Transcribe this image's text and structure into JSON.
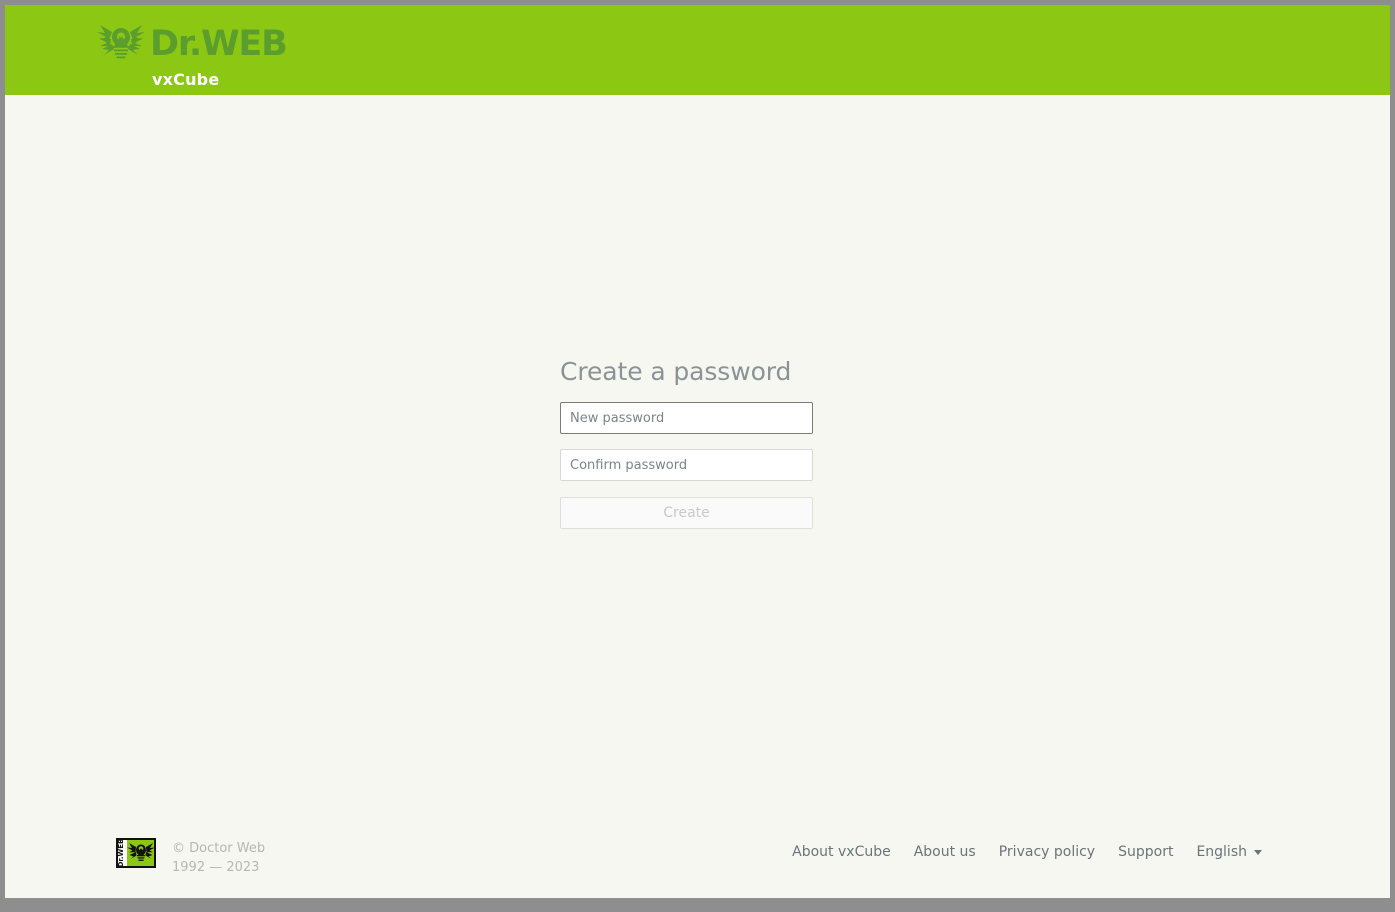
{
  "header": {
    "brand_name": "Dr.WEB",
    "product_name": "vxCube",
    "logo_icon": "dr-web-spider-icon",
    "background_color": "#8cc813",
    "wordmark_color": "#5c9e2e"
  },
  "main": {
    "title": "Create a password",
    "new_password": {
      "placeholder": "New password",
      "value": "",
      "focused": true
    },
    "confirm_password": {
      "placeholder": "Confirm password",
      "value": "",
      "focused": false
    },
    "submit": {
      "label": "Create",
      "disabled": true
    }
  },
  "footer": {
    "badge_icon": "dr-web-badge-icon",
    "badge_text": "Dr.WEB",
    "copyright_line1": "© Doctor Web",
    "copyright_line2": "1992 — 2023",
    "links": [
      {
        "label": "About vxCube"
      },
      {
        "label": "About us"
      },
      {
        "label": "Privacy policy"
      },
      {
        "label": "Support"
      }
    ],
    "language": {
      "label": "English",
      "caret_icon": "chevron-down-icon"
    }
  },
  "theme": {
    "page_background": "#f7f7f2",
    "window_border": "#8e8e8e",
    "accent_green": "#8cc813",
    "text_muted": "#b6b6b2"
  }
}
